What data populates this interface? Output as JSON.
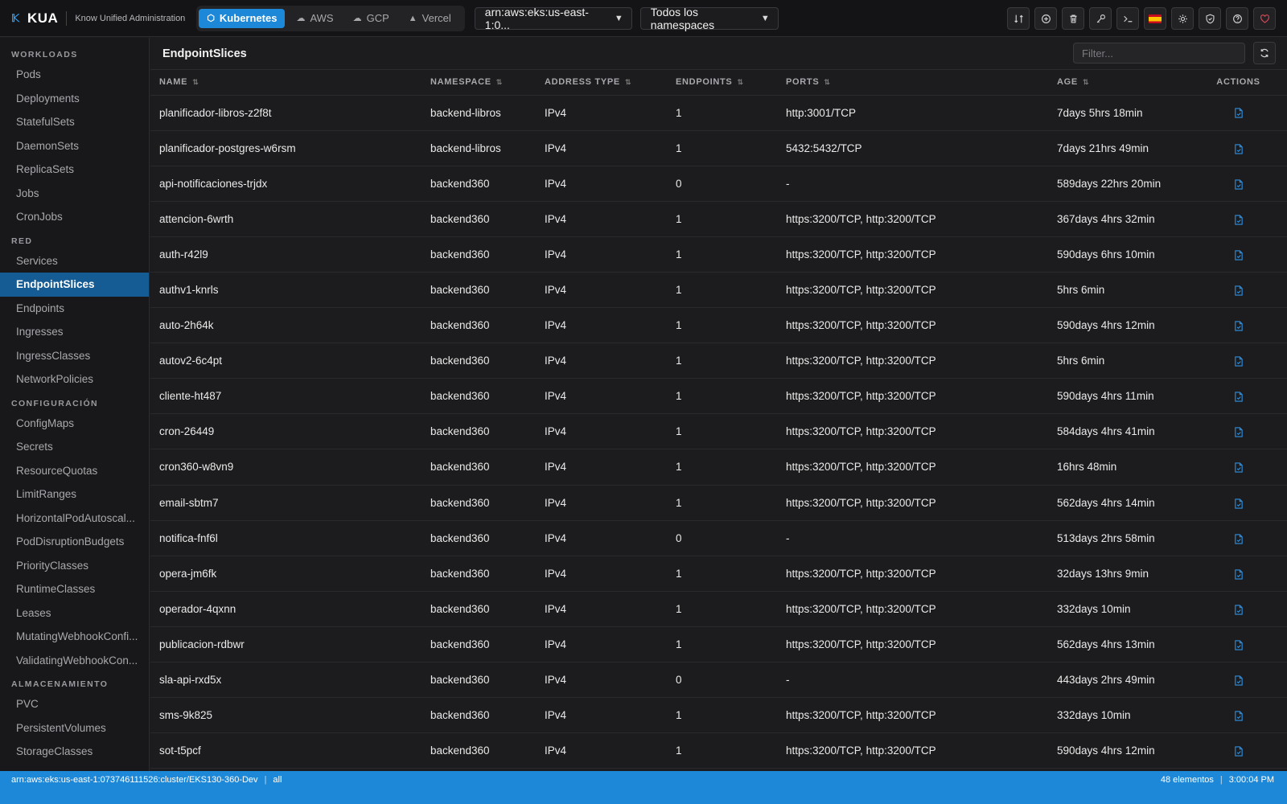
{
  "app": {
    "logo": "KUA",
    "subtitle": "Know Unified Administration"
  },
  "providers": [
    {
      "label": "Kubernetes",
      "icon": "cube-icon",
      "active": true
    },
    {
      "label": "AWS",
      "icon": "cloud-icon",
      "active": false
    },
    {
      "label": "GCP",
      "icon": "cloud-upload-icon",
      "active": false
    },
    {
      "label": "Vercel",
      "icon": "triangle-icon",
      "active": false
    }
  ],
  "cluster_select": "arn:aws:eks:us-east-1:0...",
  "namespace_select": "Todos los namespaces",
  "toolbar": [
    "transfer-icon",
    "plus-circle-icon",
    "trash-icon",
    "key-icon",
    "terminal-icon",
    "spain-flag-icon",
    "sun-icon",
    "shield-icon",
    "help-icon",
    "heart-icon"
  ],
  "sidebar": [
    {
      "section": "WORKLOADS",
      "items": [
        "Pods",
        "Deployments",
        "StatefulSets",
        "DaemonSets",
        "ReplicaSets",
        "Jobs",
        "CronJobs"
      ]
    },
    {
      "section": "RED",
      "items": [
        "Services",
        "EndpointSlices",
        "Endpoints",
        "Ingresses",
        "IngressClasses",
        "NetworkPolicies"
      ]
    },
    {
      "section": "CONFIGURACIÓN",
      "items": [
        "ConfigMaps",
        "Secrets",
        "ResourceQuotas",
        "LimitRanges",
        "HorizontalPodAutoscal...",
        "PodDisruptionBudgets",
        "PriorityClasses",
        "RuntimeClasses",
        "Leases",
        "MutatingWebhookConfi...",
        "ValidatingWebhookCon..."
      ]
    },
    {
      "section": "ALMACENAMIENTO",
      "items": [
        "PVC",
        "PersistentVolumes",
        "StorageClasses"
      ]
    }
  ],
  "sidebar_active": "EndpointSlices",
  "main": {
    "title": "EndpointSlices",
    "filter_placeholder": "Filter..."
  },
  "columns": [
    "NAME",
    "NAMESPACE",
    "ADDRESS TYPE",
    "ENDPOINTS",
    "PORTS",
    "AGE",
    "ACTIONS"
  ],
  "rows": [
    [
      "planificador-libros-z2f8t",
      "backend-libros",
      "IPv4",
      "1",
      "http:3001/TCP",
      "7days 5hrs 18min"
    ],
    [
      "planificador-postgres-w6rsm",
      "backend-libros",
      "IPv4",
      "1",
      "5432:5432/TCP",
      "7days 21hrs 49min"
    ],
    [
      "api-notificaciones-trjdx",
      "backend360",
      "IPv4",
      "0",
      "-",
      "589days 22hrs 20min"
    ],
    [
      "attencion-6wrth",
      "backend360",
      "IPv4",
      "1",
      "https:3200/TCP, http:3200/TCP",
      "367days 4hrs 32min"
    ],
    [
      "auth-r42l9",
      "backend360",
      "IPv4",
      "1",
      "https:3200/TCP, http:3200/TCP",
      "590days 6hrs 10min"
    ],
    [
      "authv1-knrls",
      "backend360",
      "IPv4",
      "1",
      "https:3200/TCP, http:3200/TCP",
      "5hrs 6min"
    ],
    [
      "auto-2h64k",
      "backend360",
      "IPv4",
      "1",
      "https:3200/TCP, http:3200/TCP",
      "590days 4hrs 12min"
    ],
    [
      "autov2-6c4pt",
      "backend360",
      "IPv4",
      "1",
      "https:3200/TCP, http:3200/TCP",
      "5hrs 6min"
    ],
    [
      "cliente-ht487",
      "backend360",
      "IPv4",
      "1",
      "https:3200/TCP, http:3200/TCP",
      "590days 4hrs 11min"
    ],
    [
      "cron-26449",
      "backend360",
      "IPv4",
      "1",
      "https:3200/TCP, http:3200/TCP",
      "584days 4hrs 41min"
    ],
    [
      "cron360-w8vn9",
      "backend360",
      "IPv4",
      "1",
      "https:3200/TCP, http:3200/TCP",
      "16hrs 48min"
    ],
    [
      "email-sbtm7",
      "backend360",
      "IPv4",
      "1",
      "https:3200/TCP, http:3200/TCP",
      "562days 4hrs 14min"
    ],
    [
      "notifica-fnf6l",
      "backend360",
      "IPv4",
      "0",
      "-",
      "513days 2hrs 58min"
    ],
    [
      "opera-jm6fk",
      "backend360",
      "IPv4",
      "1",
      "https:3200/TCP, http:3200/TCP",
      "32days 13hrs 9min"
    ],
    [
      "operador-4qxnn",
      "backend360",
      "IPv4",
      "1",
      "https:3200/TCP, http:3200/TCP",
      "332days 10min"
    ],
    [
      "publicacion-rdbwr",
      "backend360",
      "IPv4",
      "1",
      "https:3200/TCP, http:3200/TCP",
      "562days 4hrs 13min"
    ],
    [
      "sla-api-rxd5x",
      "backend360",
      "IPv4",
      "0",
      "-",
      "443days 2hrs 49min"
    ],
    [
      "sms-9k825",
      "backend360",
      "IPv4",
      "1",
      "https:3200/TCP, http:3200/TCP",
      "332days 10min"
    ],
    [
      "sot-t5pcf",
      "backend360",
      "IPv4",
      "1",
      "https:3200/TCP, http:3200/TCP",
      "590days 4hrs 12min"
    ]
  ],
  "statusbar": {
    "cluster": "arn:aws:eks:us-east-1:073746111526:cluster/EKS130-360-Dev",
    "scope": "all",
    "count": "48 elementos",
    "time": "3:00:04 PM"
  },
  "colors": {
    "accent": "#1e88d8",
    "sidebar_active": "#165c94",
    "background": "#1c1c1e"
  }
}
